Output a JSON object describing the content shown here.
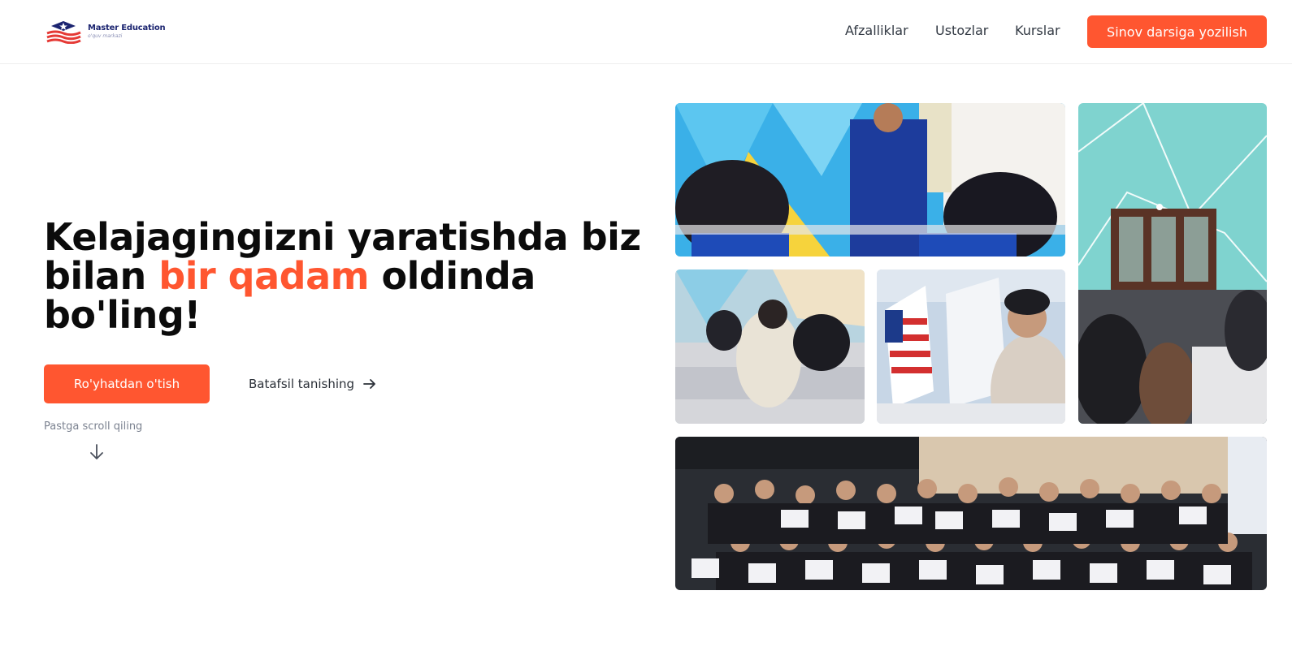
{
  "brand": {
    "name": "Master Education",
    "tagline": "o'quv markazi"
  },
  "nav": {
    "items": [
      {
        "label": "Afzalliklar"
      },
      {
        "label": "Ustozlar"
      },
      {
        "label": "Kurslar"
      }
    ],
    "cta_label": "Sinov darsiga yozilish"
  },
  "hero": {
    "title_part1": "Kelajagingizni yaratishda biz bilan ",
    "title_accent": "bir qadam",
    "title_part2": " oldinda bo'ling!",
    "primary_button": "Ro'yhatdan o'tish",
    "secondary_button": "Batafsil tanishing",
    "scroll_hint": "Pastga scroll qiling"
  },
  "colors": {
    "accent": "#ff5630",
    "brand_navy": "#1b2470",
    "text_dark": "#0b0b0b",
    "nav_text": "#333a44",
    "muted": "#7b8290"
  },
  "icons": {
    "logo": "graduation-cap-flag-logo",
    "secondary_arrow": "arrow-right-icon",
    "scroll_arrow": "arrow-down-icon"
  }
}
